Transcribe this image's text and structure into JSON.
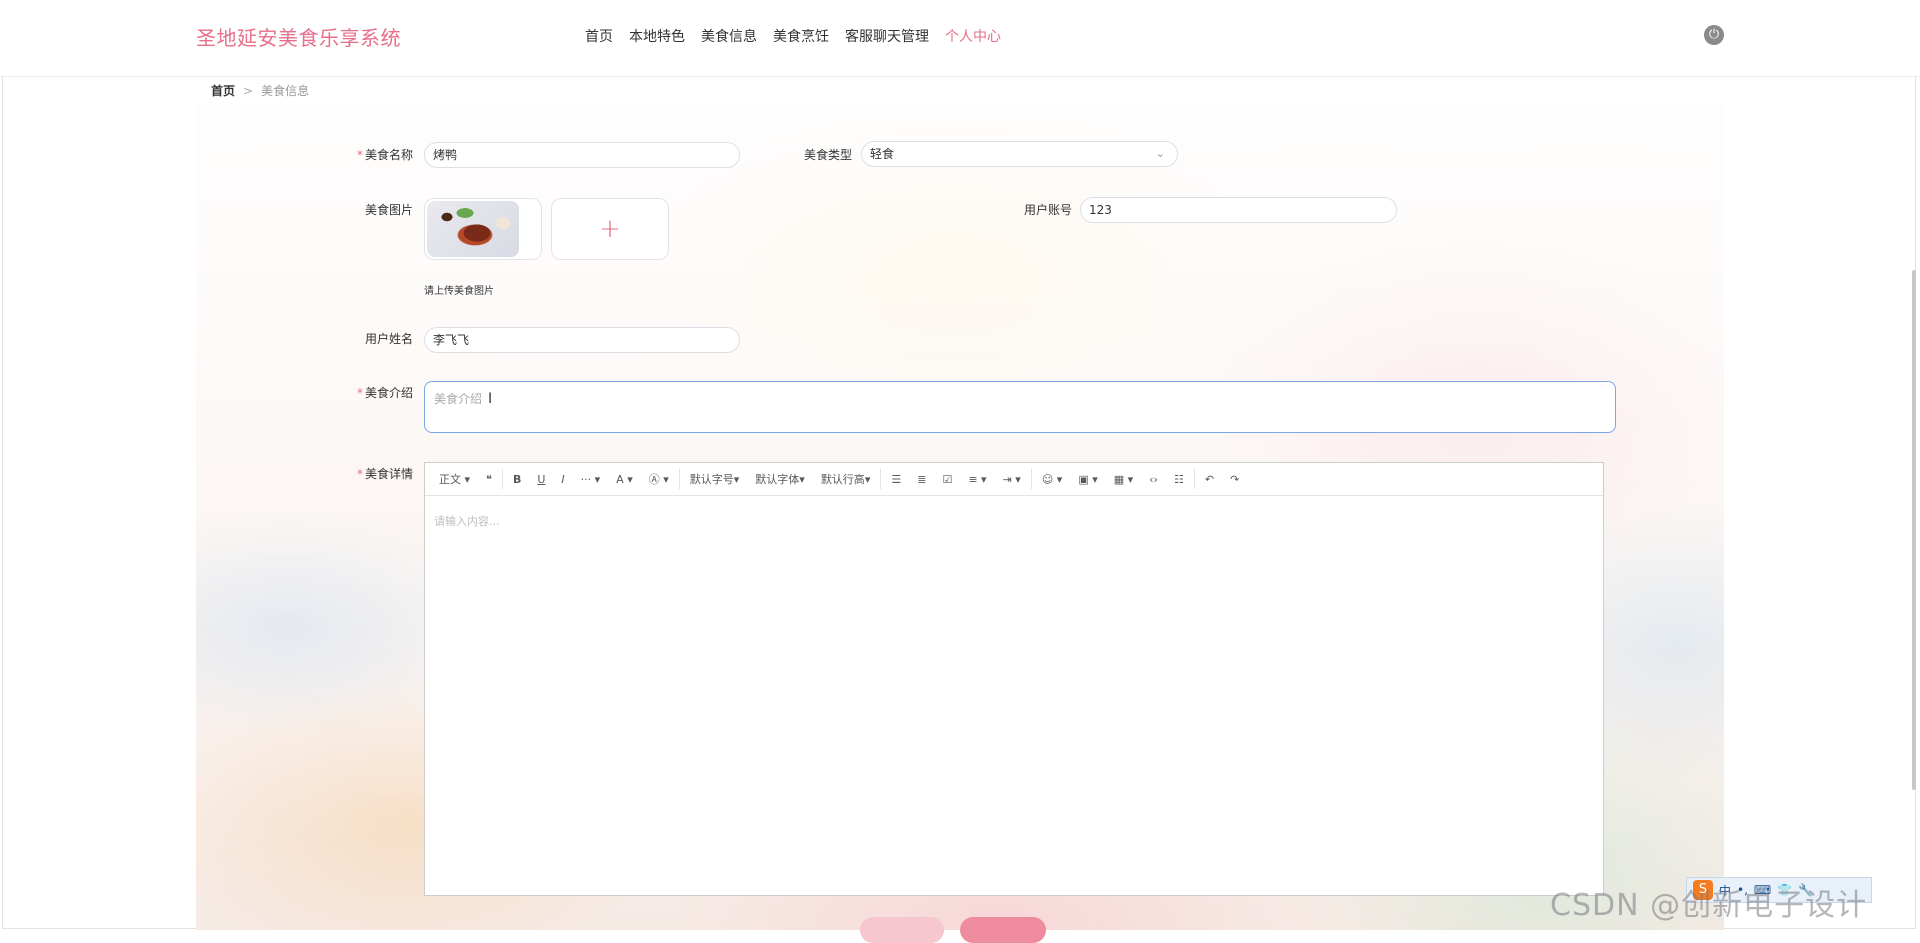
{
  "app": {
    "title": "圣地延安美食乐享系统"
  },
  "nav": {
    "items": [
      "首页",
      "本地特色",
      "美食信息",
      "美食烹饪",
      "客服聊天管理",
      "个人中心"
    ],
    "active_index": 5
  },
  "breadcrumb": {
    "home": "首页",
    "separator": ">",
    "current": "美食信息"
  },
  "form": {
    "food_name": {
      "label": "美食名称",
      "required": true,
      "value": "烤鸭"
    },
    "food_type": {
      "label": "美食类型",
      "required": false,
      "value": "轻食"
    },
    "food_image": {
      "label": "美食图片",
      "hint": "请上传美食图片",
      "add_icon": "plus-icon"
    },
    "user_account": {
      "label": "用户账号",
      "value": "123"
    },
    "user_name": {
      "label": "用户姓名",
      "value": "李飞飞"
    },
    "food_intro": {
      "label": "美食介绍",
      "required": true,
      "placeholder": "美食介绍"
    },
    "food_detail": {
      "label": "美食详情",
      "required": true,
      "placeholder": "请输入内容..."
    }
  },
  "editor_toolbar": {
    "paragraph": "正文",
    "font_size": "默认字号",
    "font_family": "默认字体",
    "line_height": "默认行高"
  },
  "colors": {
    "accent": "#e76f8a",
    "focus_border": "#7aa7e6"
  },
  "watermark": "CSDN @创新电子设计",
  "ime": {
    "label": "中"
  }
}
